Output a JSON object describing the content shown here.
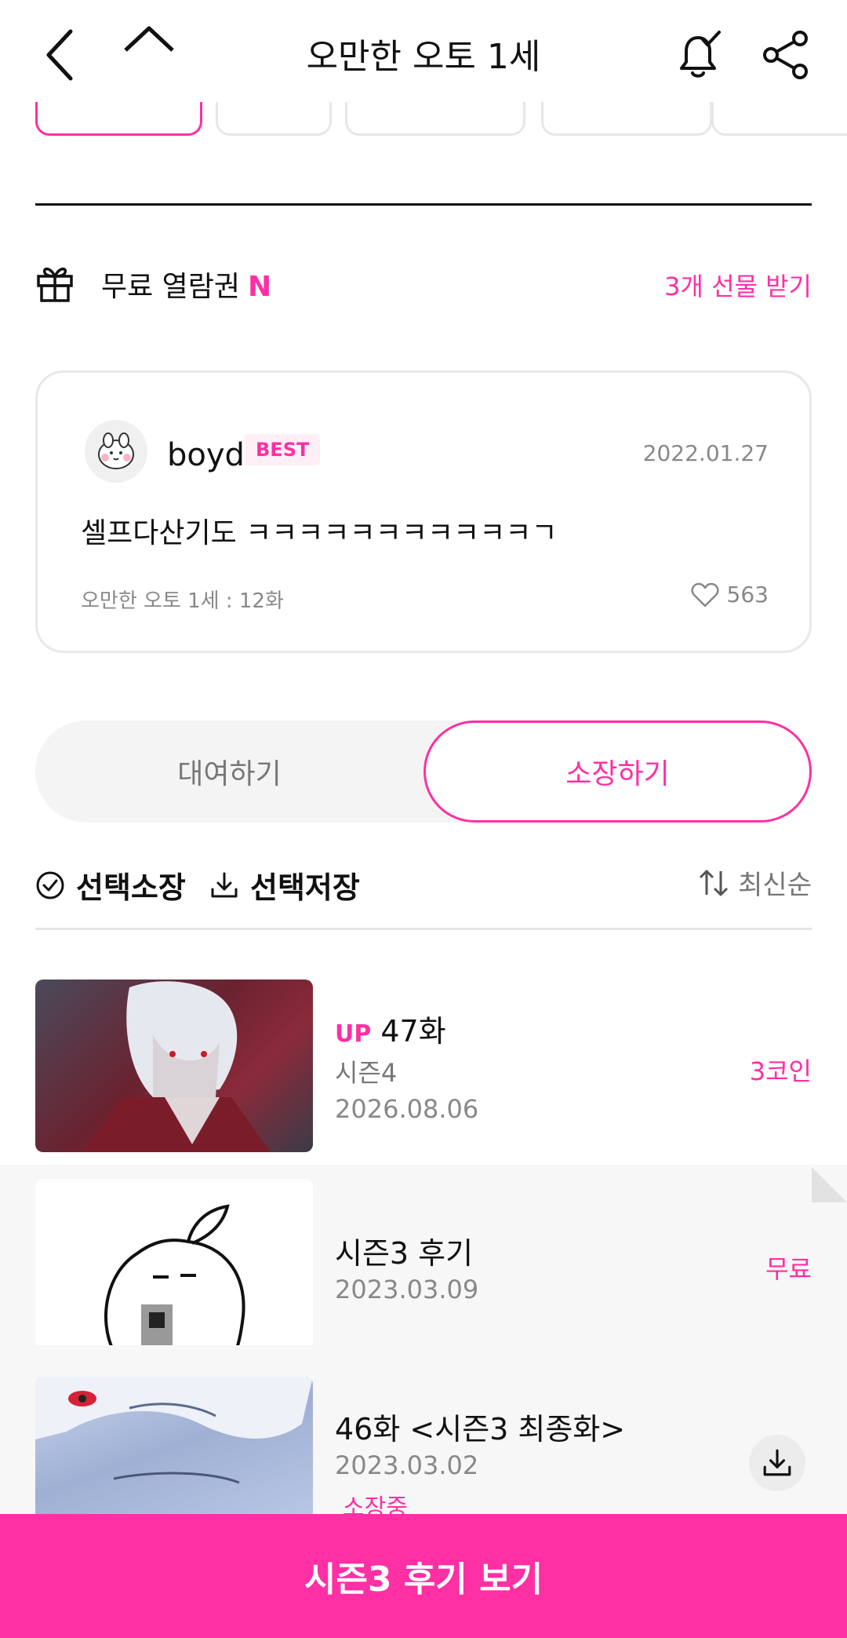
{
  "header": {
    "title": "오만한 오토 1세"
  },
  "tags": [
    "",
    "",
    "",
    "",
    ""
  ],
  "free_pass": {
    "label": "무료 열람권",
    "badge": "N",
    "gift_link": "3개 선물 받기"
  },
  "best_comment": {
    "username": "boyd",
    "badge": "BEST",
    "date": "2022.01.27",
    "text": "셀프다산기도 ㅋㅋㅋㅋㅋㅋㅋㅋㅋㅋㅋㄱ",
    "meta": "오만한 오토 1세 : 12화",
    "likes": "563"
  },
  "segment": {
    "rent": "대여하기",
    "own": "소장하기",
    "selected": "own"
  },
  "actions": {
    "select_own": "선택소장",
    "select_save": "선택저장",
    "sort": "최신순"
  },
  "episodes": [
    {
      "up": "UP",
      "title": "47화",
      "season": "시즌4",
      "date": "2026.08.06",
      "price": "3코인"
    },
    {
      "title": "시즌3 후기",
      "date": "2023.03.09",
      "price": "무료"
    },
    {
      "title": "46화 <시즌3 최종화>",
      "date": "2023.03.02",
      "status": "소장중"
    }
  ],
  "bottom_button": {
    "label": "시즌3 후기 보기"
  },
  "colors": {
    "accent": "#ff2fa4",
    "muted": "#888888"
  }
}
